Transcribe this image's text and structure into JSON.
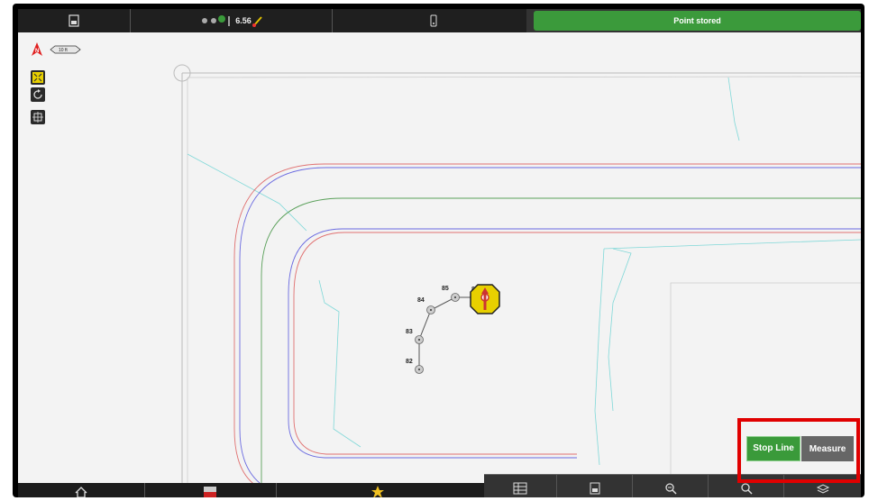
{
  "header": {
    "status_value": "6.56",
    "toast_message": "Point stored",
    "pager": {
      "pages": 4,
      "active": 0
    }
  },
  "map": {
    "scale_label": "10 ft",
    "north_label": "N",
    "points": [
      {
        "label": "82"
      },
      {
        "label": "83"
      },
      {
        "label": "84"
      },
      {
        "label": "85"
      },
      {
        "label": "86"
      }
    ]
  },
  "actions": {
    "stop_line_label": "Stop Line",
    "measure_label": "Measure"
  },
  "colors": {
    "accent_green": "#3b9a3b",
    "highlight_red": "#e00000",
    "toolbar_yellow": "#d8c100"
  }
}
